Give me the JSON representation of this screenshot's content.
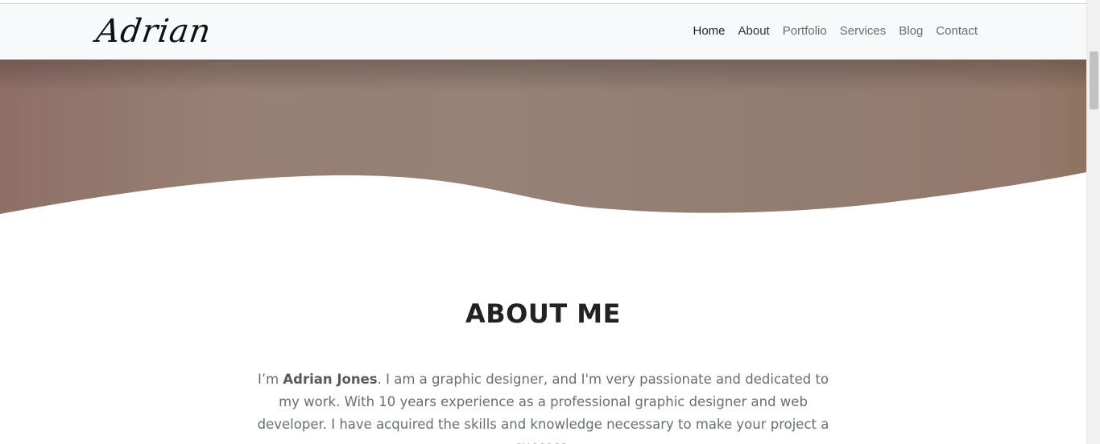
{
  "brand": {
    "logo_text": "Adrian"
  },
  "nav": {
    "items": [
      {
        "label": "Home"
      },
      {
        "label": "About"
      },
      {
        "label": "Portfolio"
      },
      {
        "label": "Services"
      },
      {
        "label": "Blog"
      },
      {
        "label": "Contact"
      }
    ]
  },
  "about": {
    "title": "ABOUT ME",
    "intro_prefix": "I’m ",
    "name": "Adrian Jones",
    "intro_rest": ". I am a graphic designer, and I'm very passionate and dedicated to my work. With 10 years experience as a professional graphic designer and web developer. I have acquired the skills and knowledge necessary to make your project a success."
  },
  "colors": {
    "navbar_bg": "#f8f9fa",
    "hero_brown": "#968276",
    "heading": "#222222",
    "body_text": "#6a6e73"
  }
}
